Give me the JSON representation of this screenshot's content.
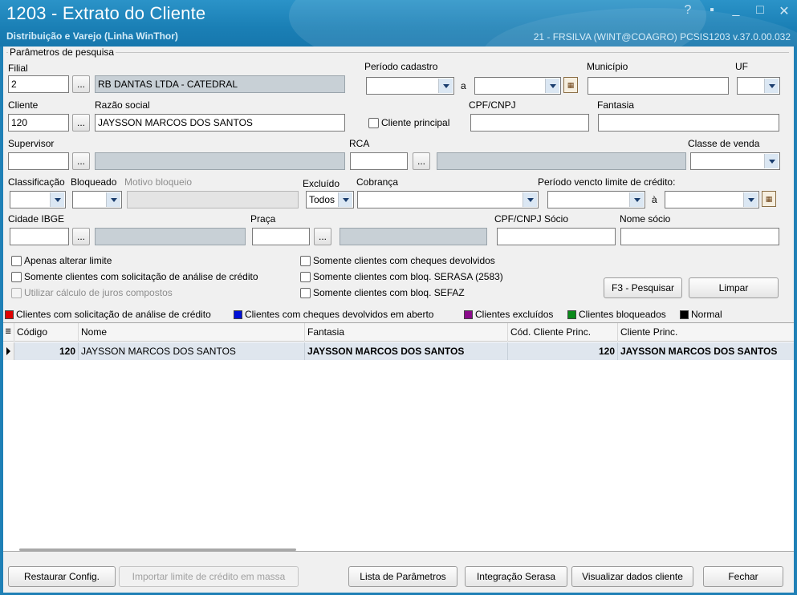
{
  "window": {
    "title": "1203 - Extrato do Cliente",
    "subtitle": "Distribuição e Varejo (Linha WinThor)",
    "status": "21 - FRSILVA (WINT@COAGRO)   PCSIS1203  v.37.0.00.032",
    "controls": [
      "?",
      "▪",
      "_",
      "□",
      "✕"
    ]
  },
  "params": {
    "group_title": "Parâmetros de pesquisa",
    "filial": {
      "label": "Filial",
      "code": "2",
      "name": "RB DANTAS LTDA - CATEDRAL",
      "dots": "..."
    },
    "periodo_cadastro": {
      "label": "Período cadastro",
      "sep": "a"
    },
    "municipio": {
      "label": "Município"
    },
    "uf": {
      "label": "UF"
    },
    "cliente": {
      "label": "Cliente",
      "value": "120"
    },
    "razao_social": {
      "label": "Razão social",
      "value": "JAYSSON MARCOS DOS SANTOS"
    },
    "cliente_principal": "Cliente principal",
    "cpf_cnpj": {
      "label": "CPF/CNPJ"
    },
    "fantasia": {
      "label": "Fantasia"
    },
    "supervisor": {
      "label": "Supervisor"
    },
    "rca": {
      "label": "RCA"
    },
    "classe_venda": {
      "label": "Classe de venda"
    },
    "classificacao": {
      "label": "Classificação"
    },
    "bloqueado": {
      "label": "Bloqueado"
    },
    "motivo_bloqueio": {
      "label": "Motivo bloqueio"
    },
    "excluido": {
      "label": "Excluído",
      "value": "Todos"
    },
    "cobranca": {
      "label": "Cobrança"
    },
    "periodo_vencto": {
      "label": "Período vencto limite de crédito:",
      "sep": "à"
    },
    "cidade_ibge": {
      "label": "Cidade IBGE"
    },
    "praca": {
      "label": "Praça"
    },
    "cpf_cnpj_socio": {
      "label": "CPF/CNPJ Sócio"
    },
    "nome_socio": {
      "label": "Nome sócio"
    },
    "checks": {
      "apenas_alterar_limite": "Apenas alterar limite",
      "somente_solicitacao": "Somente clientes com solicitação de análise de crédito",
      "utilizar_juros": "Utilizar cálculo de juros compostos",
      "cheques_devolvidos": "Somente clientes com cheques devolvidos",
      "bloq_serasa": "Somente clientes com bloq. SERASA (2583)",
      "bloq_sefaz": "Somente clientes com bloq. SEFAZ"
    },
    "buttons": {
      "pesquisar": "F3 - Pesquisar",
      "limpar": "Limpar"
    }
  },
  "legend": [
    {
      "label": "Clientes com solicitação de análise de crédito",
      "color": "#e00000"
    },
    {
      "label": "Clientes com cheques devolvidos em aberto",
      "color": "#0010d8"
    },
    {
      "label": "Clientes excluídos",
      "color": "#8a0a8a"
    },
    {
      "label": "Clientes bloqueados",
      "color": "#0a8a1a"
    },
    {
      "label": "Normal",
      "color": "#000000"
    }
  ],
  "grid": {
    "columns": [
      "Código",
      "Nome",
      "Fantasia",
      "Cód. Cliente Princ.",
      "Cliente Princ."
    ],
    "rows": [
      [
        "120",
        "JAYSSON MARCOS DOS SANTOS",
        "JAYSSON MARCOS DOS SANTOS",
        "120",
        "JAYSSON MARCOS DOS SANTOS"
      ]
    ]
  },
  "footer": {
    "restaurar": "Restaurar Config.",
    "importar": "Importar limite de crédito em massa",
    "lista": "Lista de Parâmetros",
    "integracao": "Integração Serasa",
    "visualizar": "Visualizar dados cliente",
    "fechar": "Fechar"
  }
}
